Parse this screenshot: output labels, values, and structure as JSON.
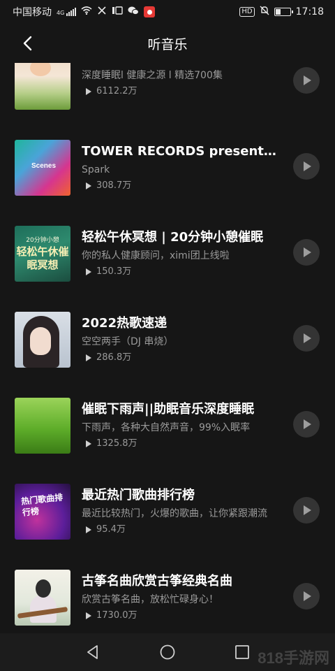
{
  "status_bar": {
    "carrier": "中国移动",
    "network": "4G",
    "time": "17:18",
    "hd": "HD",
    "battery_level": 0.35
  },
  "header": {
    "title": "听音乐"
  },
  "items": [
    {
      "title": "",
      "subtitle": "深度睡眠l 健康之源 l 精选700集",
      "plays": "6112.2万"
    },
    {
      "title": "TOWER RECORDS presents Spark",
      "subtitle": "Spark",
      "plays": "308.7万",
      "cover_text": "Scenes"
    },
    {
      "title": "轻松午休冥想 | 20分钟小憩催眠",
      "subtitle": "你的私人健康顾问，ximi团上线啦",
      "plays": "150.3万",
      "cover_text_1": "20分钟小憩",
      "cover_text_2": "轻松午休催眠冥想"
    },
    {
      "title": "2022热歌速递",
      "subtitle": "空空两手（DJ 串烧）",
      "plays": "286.8万"
    },
    {
      "title": "催眠下雨声||助眠音乐深度睡眠",
      "subtitle": "下雨声，各种大自然声音，99%入眠率",
      "plays": "1325.8万"
    },
    {
      "title": "最近热门歌曲排行榜",
      "subtitle": "最近比较热门，火爆的歌曲，让你紧跟潮流",
      "plays": "95.4万",
      "cover_text": "热门歌曲排行榜"
    },
    {
      "title": "古筝名曲欣赏古筝经典名曲",
      "subtitle": "欣赏古筝名曲，放松忙碌身心！",
      "plays": "1730.0万"
    }
  ],
  "watermark": "818手游网",
  "icons": {
    "back": "chevron-left-icon",
    "play": "play-icon",
    "nav_back": "triangle-back-icon",
    "nav_home": "circle-home-icon",
    "nav_recent": "square-recent-icon"
  }
}
